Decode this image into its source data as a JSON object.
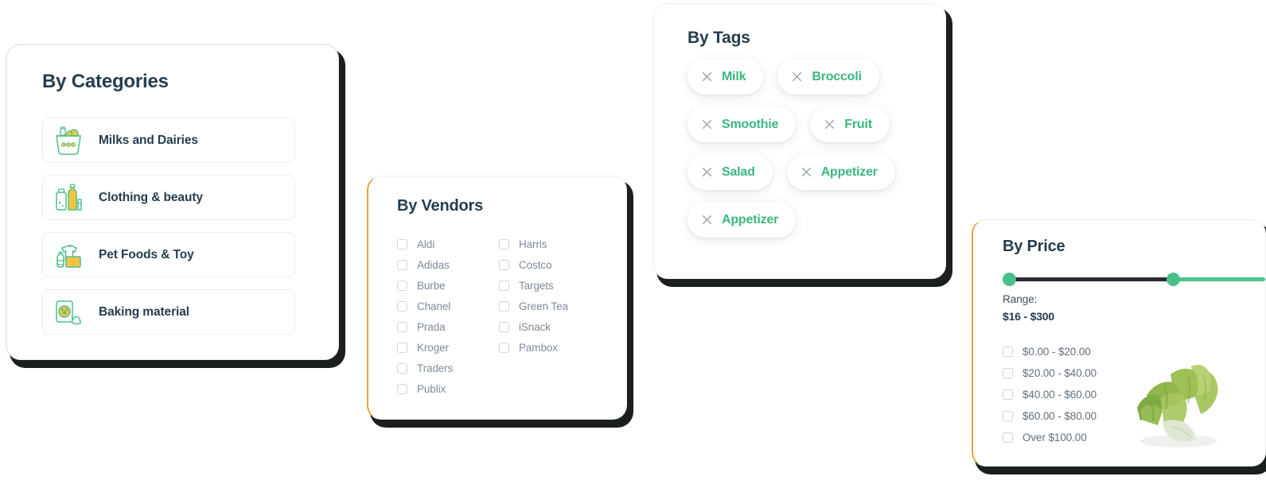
{
  "theme": {
    "accent_green": "#3BB77E",
    "accent_amber": "#E8A33D",
    "heading_color": "#253D4E",
    "muted_text": "#7E8B99"
  },
  "categories_card": {
    "title": "By Categories",
    "items": [
      {
        "label": "Milks and Dairies",
        "icon": "milk-basket-icon"
      },
      {
        "label": "Clothing & beauty",
        "icon": "bottles-icon"
      },
      {
        "label": "Pet Foods & Toy",
        "icon": "clothes-bag-icon"
      },
      {
        "label": "Baking material",
        "icon": "pet-food-icon"
      }
    ]
  },
  "vendors_card": {
    "title": "By Vendors",
    "column_one": [
      "Aldi",
      "Adidas",
      "Burbe",
      "Chanel",
      "Prada",
      "Kroger",
      "Traders",
      "Publix"
    ],
    "column_two": [
      "Harris",
      "Costco",
      "Targets",
      "Green Tea",
      "iSnack",
      "Pambox"
    ]
  },
  "tags_card": {
    "title": "By Tags",
    "tags": [
      {
        "label": "Milk",
        "remove_icon": "close-icon"
      },
      {
        "label": "Broccoli",
        "remove_icon": "close-icon"
      },
      {
        "label": "Smoothie",
        "remove_icon": "close-icon"
      },
      {
        "label": "Fruit",
        "remove_icon": "close-icon"
      },
      {
        "label": "Salad",
        "remove_icon": "close-icon"
      },
      {
        "label": "Appetizer",
        "remove_icon": "close-icon"
      },
      {
        "label": "Appetizer",
        "remove_icon": "close-icon"
      }
    ]
  },
  "price_card": {
    "title": "By Price",
    "range_label": "Range:",
    "range_value": "$16 - $300",
    "slider": {
      "min_handle_percent": 0,
      "max_handle_percent": 65
    },
    "price_ranges": [
      "$0.00 - $20.00",
      "$20.00 - $40.00",
      "$40.00 - $60.00",
      "$60.00 - $80.00",
      "Over $100.00"
    ]
  }
}
